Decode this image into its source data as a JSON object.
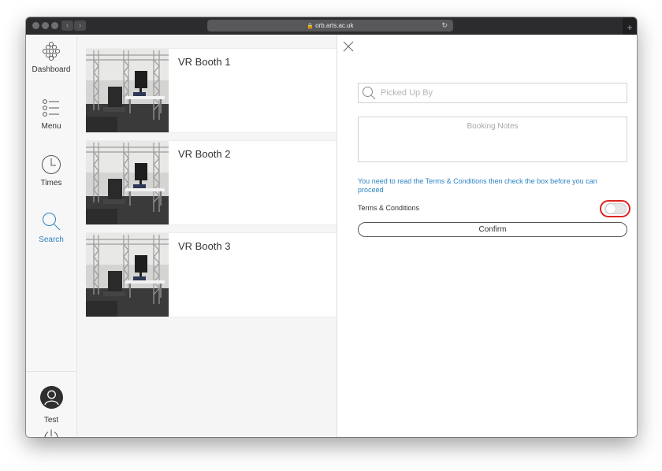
{
  "browser": {
    "url": "orb.arts.ac.uk",
    "back_glyph": "‹",
    "forward_glyph": "›",
    "reload_glyph": "↻",
    "new_tab_glyph": "+",
    "lock_glyph": "🔒"
  },
  "sidebar": {
    "items": [
      {
        "label": "Dashboard",
        "icon": "dashboard-icon"
      },
      {
        "label": "Menu",
        "icon": "menu-list-icon"
      },
      {
        "label": "Times",
        "icon": "clock-icon"
      },
      {
        "label": "Search",
        "icon": "search-icon",
        "active": true
      }
    ],
    "user": {
      "name": "Test",
      "icon": "user-avatar-icon"
    },
    "power_icon": "power-icon"
  },
  "resources": [
    {
      "name": "VR Booth 1"
    },
    {
      "name": "VR Booth 2"
    },
    {
      "name": "VR Booth 3"
    }
  ],
  "booking_form": {
    "picked_up_by_placeholder": "Picked Up By",
    "notes_placeholder": "Booking Notes",
    "terms_notice": "You need to read the Terms & Conditions then check the box before you can proceed",
    "terms_label": "Terms & Conditions",
    "terms_accepted": false,
    "confirm_label": "Confirm"
  },
  "colors": {
    "accent": "#2c83c2",
    "highlight_ring": "#e0231f",
    "sidebar_bg": "#f7f7f7"
  }
}
